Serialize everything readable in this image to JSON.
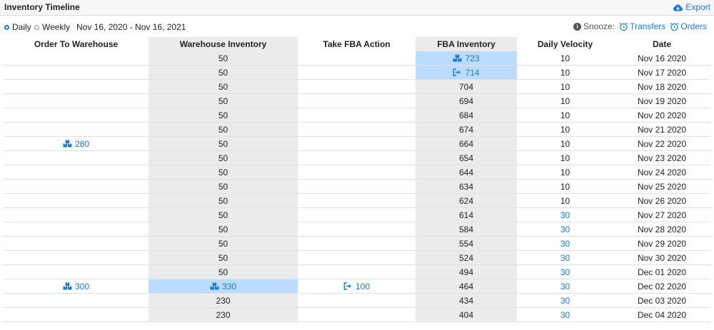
{
  "header": {
    "title": "Inventory Timeline",
    "export_label": "Export"
  },
  "controls": {
    "daily_label": "Daily",
    "weekly_label": "Weekly",
    "selected_view": "Daily",
    "date_range": "Nov 16, 2020 - Nov 16, 2021",
    "snooze_label": "Snooze:",
    "transfers_label": "Transfers",
    "orders_label": "Orders"
  },
  "colors": {
    "accent": "#1a78d4",
    "highlight": "#bcdcff",
    "shaded_column": "#ebebeb"
  },
  "columns": [
    "Order To Warehouse",
    "Warehouse Inventory",
    "Take FBA Action",
    "FBA Inventory",
    "Daily Velocity",
    "Date"
  ],
  "rows": [
    {
      "order": "",
      "order_icon": "",
      "warehouse": "50",
      "warehouse_icon": "",
      "warehouse_hl": false,
      "fba_action": "",
      "fba_action_icon": "",
      "fba": "723",
      "fba_icon": "boxes-icon",
      "fba_hl": true,
      "velocity": "10",
      "velocity_blue": false,
      "date": "Nov 16 2020"
    },
    {
      "order": "",
      "order_icon": "",
      "warehouse": "50",
      "warehouse_icon": "",
      "warehouse_hl": false,
      "fba_action": "",
      "fba_action_icon": "",
      "fba": "714",
      "fba_icon": "send-icon",
      "fba_hl": true,
      "velocity": "10",
      "velocity_blue": false,
      "date": "Nov 17 2020"
    },
    {
      "order": "",
      "order_icon": "",
      "warehouse": "50",
      "warehouse_icon": "",
      "warehouse_hl": false,
      "fba_action": "",
      "fba_action_icon": "",
      "fba": "704",
      "fba_icon": "",
      "fba_hl": false,
      "velocity": "10",
      "velocity_blue": false,
      "date": "Nov 18 2020"
    },
    {
      "order": "",
      "order_icon": "",
      "warehouse": "50",
      "warehouse_icon": "",
      "warehouse_hl": false,
      "fba_action": "",
      "fba_action_icon": "",
      "fba": "694",
      "fba_icon": "",
      "fba_hl": false,
      "velocity": "10",
      "velocity_blue": false,
      "date": "Nov 19 2020"
    },
    {
      "order": "",
      "order_icon": "",
      "warehouse": "50",
      "warehouse_icon": "",
      "warehouse_hl": false,
      "fba_action": "",
      "fba_action_icon": "",
      "fba": "684",
      "fba_icon": "",
      "fba_hl": false,
      "velocity": "10",
      "velocity_blue": false,
      "date": "Nov 20 2020"
    },
    {
      "order": "",
      "order_icon": "",
      "warehouse": "50",
      "warehouse_icon": "",
      "warehouse_hl": false,
      "fba_action": "",
      "fba_action_icon": "",
      "fba": "674",
      "fba_icon": "",
      "fba_hl": false,
      "velocity": "10",
      "velocity_blue": false,
      "date": "Nov 21 2020"
    },
    {
      "order": "280",
      "order_icon": "boxes-icon",
      "warehouse": "50",
      "warehouse_icon": "",
      "warehouse_hl": false,
      "fba_action": "",
      "fba_action_icon": "",
      "fba": "664",
      "fba_icon": "",
      "fba_hl": false,
      "velocity": "10",
      "velocity_blue": false,
      "date": "Nov 22 2020"
    },
    {
      "order": "",
      "order_icon": "",
      "warehouse": "50",
      "warehouse_icon": "",
      "warehouse_hl": false,
      "fba_action": "",
      "fba_action_icon": "",
      "fba": "654",
      "fba_icon": "",
      "fba_hl": false,
      "velocity": "10",
      "velocity_blue": false,
      "date": "Nov 23 2020"
    },
    {
      "order": "",
      "order_icon": "",
      "warehouse": "50",
      "warehouse_icon": "",
      "warehouse_hl": false,
      "fba_action": "",
      "fba_action_icon": "",
      "fba": "644",
      "fba_icon": "",
      "fba_hl": false,
      "velocity": "10",
      "velocity_blue": false,
      "date": "Nov 24 2020"
    },
    {
      "order": "",
      "order_icon": "",
      "warehouse": "50",
      "warehouse_icon": "",
      "warehouse_hl": false,
      "fba_action": "",
      "fba_action_icon": "",
      "fba": "634",
      "fba_icon": "",
      "fba_hl": false,
      "velocity": "10",
      "velocity_blue": false,
      "date": "Nov 25 2020"
    },
    {
      "order": "",
      "order_icon": "",
      "warehouse": "50",
      "warehouse_icon": "",
      "warehouse_hl": false,
      "fba_action": "",
      "fba_action_icon": "",
      "fba": "624",
      "fba_icon": "",
      "fba_hl": false,
      "velocity": "10",
      "velocity_blue": false,
      "date": "Nov 26 2020"
    },
    {
      "order": "",
      "order_icon": "",
      "warehouse": "50",
      "warehouse_icon": "",
      "warehouse_hl": false,
      "fba_action": "",
      "fba_action_icon": "",
      "fba": "614",
      "fba_icon": "",
      "fba_hl": false,
      "velocity": "30",
      "velocity_blue": true,
      "date": "Nov 27 2020"
    },
    {
      "order": "",
      "order_icon": "",
      "warehouse": "50",
      "warehouse_icon": "",
      "warehouse_hl": false,
      "fba_action": "",
      "fba_action_icon": "",
      "fba": "584",
      "fba_icon": "",
      "fba_hl": false,
      "velocity": "30",
      "velocity_blue": true,
      "date": "Nov 28 2020"
    },
    {
      "order": "",
      "order_icon": "",
      "warehouse": "50",
      "warehouse_icon": "",
      "warehouse_hl": false,
      "fba_action": "",
      "fba_action_icon": "",
      "fba": "554",
      "fba_icon": "",
      "fba_hl": false,
      "velocity": "30",
      "velocity_blue": true,
      "date": "Nov 29 2020"
    },
    {
      "order": "",
      "order_icon": "",
      "warehouse": "50",
      "warehouse_icon": "",
      "warehouse_hl": false,
      "fba_action": "",
      "fba_action_icon": "",
      "fba": "524",
      "fba_icon": "",
      "fba_hl": false,
      "velocity": "30",
      "velocity_blue": true,
      "date": "Nov 30 2020"
    },
    {
      "order": "",
      "order_icon": "",
      "warehouse": "50",
      "warehouse_icon": "",
      "warehouse_hl": false,
      "fba_action": "",
      "fba_action_icon": "",
      "fba": "494",
      "fba_icon": "",
      "fba_hl": false,
      "velocity": "30",
      "velocity_blue": true,
      "date": "Dec 01 2020"
    },
    {
      "order": "300",
      "order_icon": "boxes-icon",
      "warehouse": "330",
      "warehouse_icon": "boxes-icon",
      "warehouse_hl": true,
      "fba_action": "100",
      "fba_action_icon": "send-icon",
      "fba": "464",
      "fba_icon": "",
      "fba_hl": false,
      "velocity": "30",
      "velocity_blue": true,
      "date": "Dec 02 2020"
    },
    {
      "order": "",
      "order_icon": "",
      "warehouse": "230",
      "warehouse_icon": "",
      "warehouse_hl": false,
      "fba_action": "",
      "fba_action_icon": "",
      "fba": "434",
      "fba_icon": "",
      "fba_hl": false,
      "velocity": "30",
      "velocity_blue": true,
      "date": "Dec 03 2020"
    },
    {
      "order": "",
      "order_icon": "",
      "warehouse": "230",
      "warehouse_icon": "",
      "warehouse_hl": false,
      "fba_action": "",
      "fba_action_icon": "",
      "fba": "404",
      "fba_icon": "",
      "fba_hl": false,
      "velocity": "30",
      "velocity_blue": true,
      "date": "Dec 04 2020"
    }
  ]
}
